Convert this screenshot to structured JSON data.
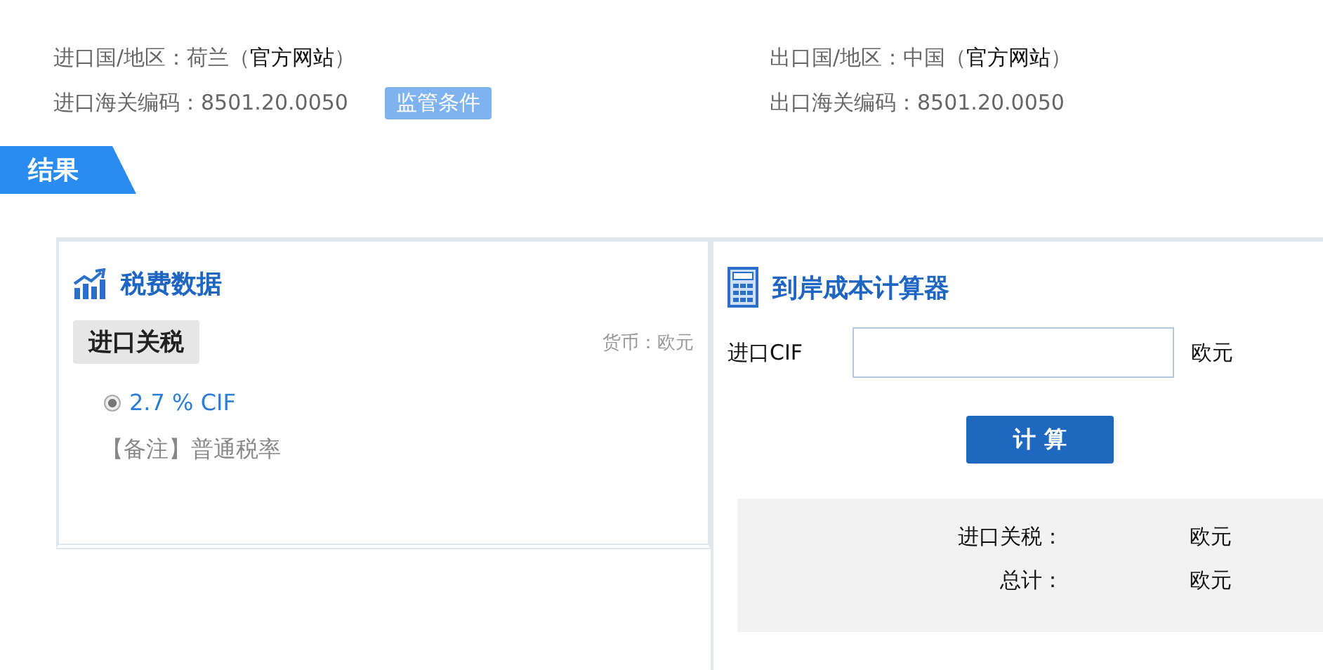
{
  "origin": {
    "import": {
      "country_label": "进口国/地区：荷兰（",
      "link": "官方网站",
      "close": "）",
      "code": "进口海关编码：8501.20.0050",
      "button": "监管条件"
    },
    "export": {
      "country_label": "出口国/地区：中国（",
      "link": "官方网站",
      "close": "）",
      "code": "出口海关编码：8501.20.0050"
    }
  },
  "section_tab": "结果",
  "tax_panel": {
    "title": "税费数据",
    "tag": "进口关税",
    "currency": "货币：欧元",
    "rates": [
      {
        "label": "2.7 % CIF",
        "selected": true
      }
    ],
    "note": "【备注】普通税率"
  },
  "calculator": {
    "title": "到岸成本计算器",
    "input_label": "进口CIF",
    "unit": "欧元",
    "button": "计 算",
    "results": [
      {
        "label": "进口关税：",
        "unit": "欧元"
      },
      {
        "label": "总计：",
        "unit": "欧元"
      }
    ]
  }
}
